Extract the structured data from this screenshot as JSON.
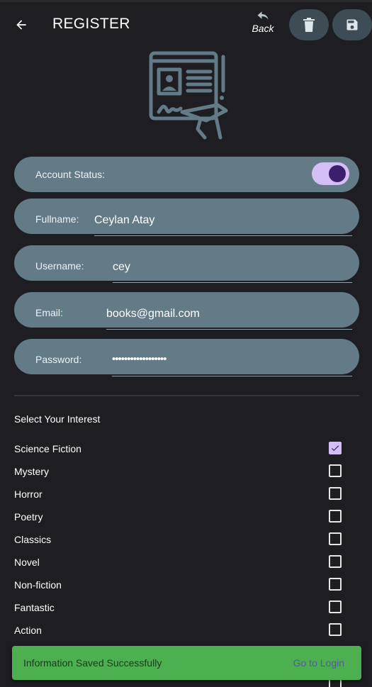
{
  "header": {
    "title": "REGISTER",
    "back_text": "Back"
  },
  "form": {
    "account_status_label": "Account Status:",
    "account_status_on": true,
    "fullname_label": "Fullname:",
    "fullname_value": "Ceylan Atay",
    "username_label": "Username:",
    "username_value": "cey",
    "email_label": "Email:",
    "email_value": "books@gmail.com",
    "password_label": "Password:",
    "password_value": "••••••••••••••••••"
  },
  "interests": {
    "title": "Select Your Interest",
    "items": [
      {
        "label": "Science Fiction",
        "checked": true
      },
      {
        "label": "Mystery",
        "checked": false
      },
      {
        "label": "Horror",
        "checked": false
      },
      {
        "label": "Poetry",
        "checked": false
      },
      {
        "label": "Classics",
        "checked": false
      },
      {
        "label": "Novel",
        "checked": false
      },
      {
        "label": "Non-fiction",
        "checked": false
      },
      {
        "label": "Fantastic",
        "checked": false
      },
      {
        "label": "Action",
        "checked": false
      }
    ]
  },
  "snackbar": {
    "message": "Information Saved Successfully",
    "action": "Go to Login"
  },
  "colors": {
    "background": "#1e1d21",
    "field_fill": "#627b87",
    "accent": "#d3bef5",
    "snackbar": "#4caf50",
    "icon_button": "#3e4d55"
  },
  "icons": [
    "arrow-back-icon",
    "undo-icon",
    "trash-icon",
    "save-icon",
    "register-illustration",
    "check-icon"
  ]
}
